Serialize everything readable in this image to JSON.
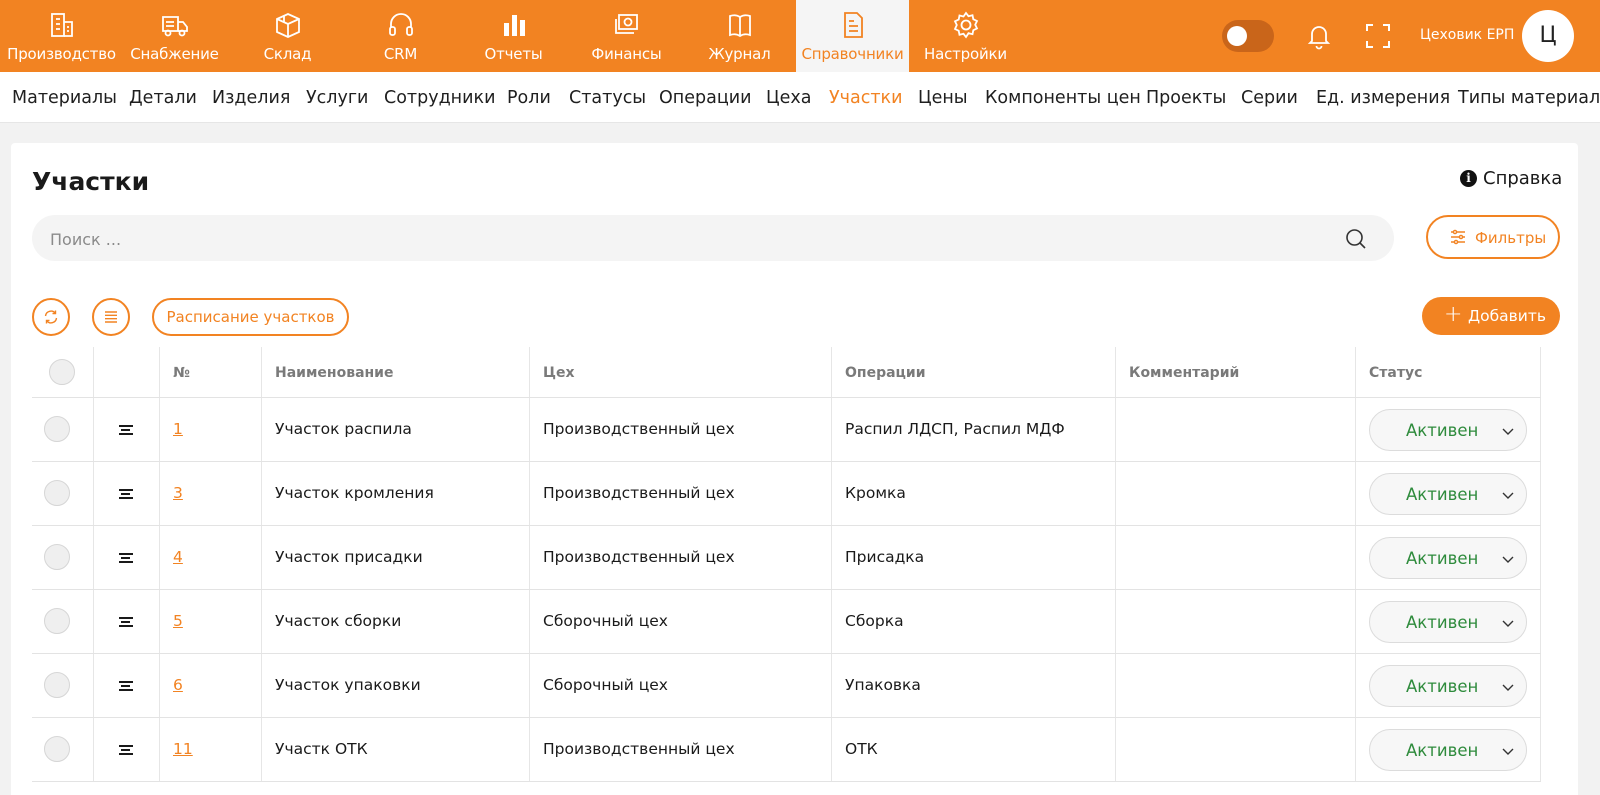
{
  "topnav": {
    "items": [
      {
        "label": "Производство",
        "icon": "factory-icon"
      },
      {
        "label": "Снабжение",
        "icon": "truck-icon"
      },
      {
        "label": "Склад",
        "icon": "box-icon"
      },
      {
        "label": "CRM",
        "icon": "headset-icon"
      },
      {
        "label": "Отчеты",
        "icon": "bar-chart-icon"
      },
      {
        "label": "Финансы",
        "icon": "money-icon"
      },
      {
        "label": "Журнал",
        "icon": "book-icon"
      },
      {
        "label": "Справочники",
        "icon": "document-icon",
        "active": true
      },
      {
        "label": "Настройки",
        "icon": "gear-icon"
      }
    ],
    "user_name": "Цеховик ЕРП",
    "avatar_letter": "Ц",
    "accent_color": "#f28322"
  },
  "subnav": {
    "items": [
      "Материалы",
      "Детали",
      "Изделия",
      "Услуги",
      "Сотрудники",
      "Роли",
      "Статусы",
      "Операции",
      "Цеха",
      "Участки",
      "Цены",
      "Компоненты цен",
      "Проекты",
      "Серии",
      "Ед. измерения",
      "Типы материалов"
    ],
    "active": "Участки"
  },
  "page": {
    "title": "Участки",
    "help_label": "Справка",
    "search_placeholder": "Поиск ...",
    "filters_label": "Фильтры",
    "schedule_label": "Расписание участков",
    "add_label": "Добавить"
  },
  "table": {
    "headers": [
      "№",
      "Наименование",
      "Цех",
      "Операции",
      "Комментарий",
      "Статус"
    ],
    "rows": [
      {
        "num": "1",
        "name": "Участок распила",
        "shop": "Производственный цех",
        "ops": "Распил ЛДСП, Распил МДФ",
        "comment": "",
        "status": "Активен"
      },
      {
        "num": "3",
        "name": "Участок кромления",
        "shop": "Производственный цех",
        "ops": "Кромка",
        "comment": "",
        "status": "Активен"
      },
      {
        "num": "4",
        "name": "Участок присадки",
        "shop": "Производственный цех",
        "ops": "Присадка",
        "comment": "",
        "status": "Активен"
      },
      {
        "num": "5",
        "name": "Участок сборки",
        "shop": "Сборочный цех",
        "ops": "Сборка",
        "comment": "",
        "status": "Активен"
      },
      {
        "num": "6",
        "name": "Участок упаковки",
        "shop": "Сборочный цех",
        "ops": "Упаковка",
        "comment": "",
        "status": "Активен"
      },
      {
        "num": "11",
        "name": "Участк ОТК",
        "shop": "Производственный цех",
        "ops": "ОТК",
        "comment": "",
        "status": "Активен"
      }
    ],
    "status_color": "#2e8b3c"
  }
}
